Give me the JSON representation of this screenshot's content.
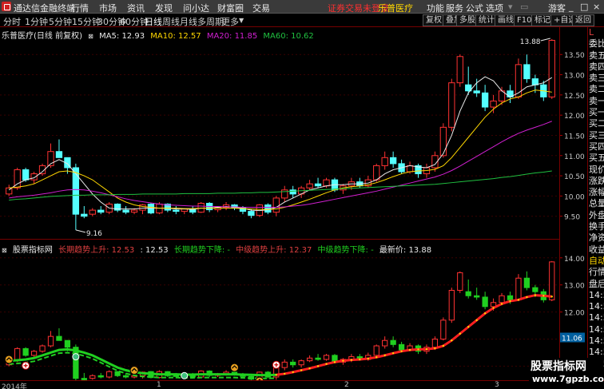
{
  "menubar": {
    "app_title": "通达信金融终端",
    "items": [
      "行情",
      "市场",
      "资讯",
      "发现",
      "问小达",
      "财富圈",
      "交易"
    ],
    "alert": "证券交易未登录",
    "symbol": "乐普医疗",
    "right_items": [
      "功能",
      "服务",
      "公式",
      "选项"
    ],
    "guest": "游客"
  },
  "periodbar": {
    "periods": [
      "分时",
      "1分钟",
      "5分钟",
      "15分钟",
      "30分钟",
      "60分钟",
      "日线",
      "周线",
      "月线",
      "多周期",
      "更多"
    ],
    "active": "日线",
    "tools": [
      "复权",
      "叠加",
      "多股",
      "统计",
      "画线",
      "F10",
      "标记",
      "+自选",
      "返回"
    ]
  },
  "main": {
    "title": "乐普医疗(日线 前复权)",
    "ma": [
      {
        "label": "MA5: 12.93",
        "color": "#e8e8e8"
      },
      {
        "label": "MA10: 12.57",
        "color": "#ffd700"
      },
      {
        "label": "MA20: 11.85",
        "color": "#d020d0"
      },
      {
        "label": "MA60: 10.62",
        "color": "#20c040"
      }
    ],
    "high_label": "13.88",
    "low_label": "9.16"
  },
  "axis": {
    "main_ticks": [
      "13.50",
      "13.00",
      "12.50",
      "12.00",
      "11.50",
      "11.00",
      "10.50",
      "10.00",
      "9.50"
    ],
    "sub_ticks": [
      "14.00",
      "13.00",
      "12.00",
      "11.00",
      "10.00"
    ],
    "current_price": "11.06"
  },
  "sub": {
    "name": "股票指标网",
    "labels": [
      {
        "text": "长期趋势上升: 12.53",
        "color": "#e04040"
      },
      {
        "text": ": 12.53",
        "color": "#e8e8e8"
      },
      {
        "text": "长期趋势下降: -",
        "color": "#20d020"
      },
      {
        "text": "中级趋势上升: 12.37",
        "color": "#e04040"
      },
      {
        "text": "中级趋势下降: -",
        "color": "#20d020"
      },
      {
        "text": "最新价: 13.88",
        "color": "#e8e8e8"
      }
    ]
  },
  "sidepanel": {
    "items": [
      {
        "text": "L",
        "cls": "red"
      },
      {
        "text": "委比",
        "cls": "wht"
      },
      {
        "text": "卖五",
        "cls": "wht"
      },
      {
        "text": "卖四",
        "cls": "wht"
      },
      {
        "text": "卖三",
        "cls": "wht"
      },
      {
        "text": "卖二",
        "cls": "wht"
      },
      {
        "text": "卖一",
        "cls": "wht"
      },
      {
        "text": "买一",
        "cls": "wht"
      },
      {
        "text": "买二",
        "cls": "wht"
      },
      {
        "text": "买三",
        "cls": "wht"
      },
      {
        "text": "买四",
        "cls": "wht"
      },
      {
        "text": "买五",
        "cls": "wht"
      },
      {
        "text": "现价",
        "cls": "wht"
      },
      {
        "text": "涨跌",
        "cls": "wht"
      },
      {
        "text": "涨幅",
        "cls": "wht"
      },
      {
        "text": "总量",
        "cls": "wht"
      },
      {
        "text": "外盘",
        "cls": "wht"
      },
      {
        "text": "换手",
        "cls": "wht"
      },
      {
        "text": "净资",
        "cls": "wht"
      },
      {
        "text": "收益",
        "cls": "wht"
      },
      {
        "text": "自动",
        "cls": "yel"
      },
      {
        "text": "行情",
        "cls": "wht"
      },
      {
        "text": "盘后",
        "cls": "wht"
      },
      {
        "text": "14:50",
        "cls": "wht"
      },
      {
        "text": "14:50",
        "cls": "wht"
      },
      {
        "text": "14:50",
        "cls": "wht"
      },
      {
        "text": "14:50",
        "cls": "wht"
      },
      {
        "text": "14:50",
        "cls": "wht"
      },
      {
        "text": "14:50",
        "cls": "wht"
      },
      {
        "text": "14:51",
        "cls": "wht"
      }
    ]
  },
  "timeline": {
    "labels": [
      "2014年",
      "1",
      "2",
      "3"
    ]
  },
  "watermark": {
    "title": "股票指标网",
    "url": "www.7gpzb.com"
  },
  "colors": {
    "up": "#ff3232",
    "down": "#54ffff",
    "bg": "#000000",
    "grid": "#700000"
  },
  "chart_data": {
    "type": "candlestick",
    "candles": [
      [
        10.05,
        10.28,
        10.0,
        10.2
      ],
      [
        10.2,
        10.7,
        10.15,
        10.65
      ],
      [
        10.65,
        10.7,
        10.35,
        10.4
      ],
      [
        10.4,
        10.6,
        10.3,
        10.55
      ],
      [
        10.55,
        10.8,
        10.5,
        10.75
      ],
      [
        10.75,
        11.3,
        10.7,
        11.1
      ],
      [
        11.1,
        11.4,
        10.95,
        10.95
      ],
      [
        10.95,
        10.95,
        10.55,
        10.7
      ],
      [
        10.7,
        10.8,
        9.16,
        9.55
      ],
      [
        9.55,
        9.75,
        9.45,
        9.5
      ],
      [
        9.55,
        9.7,
        9.5,
        9.65
      ],
      [
        9.65,
        9.75,
        9.55,
        9.6
      ],
      [
        9.6,
        9.85,
        9.55,
        9.8
      ],
      [
        9.8,
        9.82,
        9.6,
        9.65
      ],
      [
        9.65,
        9.75,
        9.55,
        9.6
      ],
      [
        9.6,
        9.7,
        9.55,
        9.65
      ],
      [
        9.65,
        9.8,
        9.55,
        9.78
      ],
      [
        9.8,
        9.82,
        9.55,
        9.58
      ],
      [
        9.58,
        9.85,
        9.55,
        9.8
      ],
      [
        9.8,
        9.82,
        9.6,
        9.65
      ],
      [
        9.65,
        9.75,
        9.55,
        9.62
      ],
      [
        9.62,
        9.7,
        9.55,
        9.68
      ],
      [
        9.68,
        9.75,
        9.55,
        9.6
      ],
      [
        9.6,
        9.85,
        9.58,
        9.82
      ],
      [
        9.82,
        9.85,
        9.6,
        9.66
      ],
      [
        9.66,
        9.75,
        9.6,
        9.72
      ],
      [
        9.72,
        9.85,
        9.65,
        9.78
      ],
      [
        9.78,
        9.8,
        9.65,
        9.7
      ],
      [
        9.7,
        9.75,
        9.55,
        9.62
      ],
      [
        9.62,
        9.68,
        9.45,
        9.52
      ],
      [
        9.52,
        9.8,
        9.48,
        9.78
      ],
      [
        9.78,
        9.82,
        9.55,
        9.6
      ],
      [
        9.6,
        10.0,
        9.5,
        9.95
      ],
      [
        9.95,
        10.25,
        9.85,
        10.15
      ],
      [
        10.15,
        10.25,
        9.95,
        10.05
      ],
      [
        10.05,
        10.25,
        9.95,
        10.2
      ],
      [
        10.2,
        10.4,
        10.15,
        10.3
      ],
      [
        10.3,
        10.45,
        10.2,
        10.25
      ],
      [
        10.25,
        10.45,
        10.2,
        10.4
      ],
      [
        10.4,
        10.45,
        10.1,
        10.15
      ],
      [
        10.15,
        10.3,
        10.05,
        10.25
      ],
      [
        10.25,
        10.45,
        10.15,
        10.35
      ],
      [
        10.35,
        10.45,
        10.2,
        10.25
      ],
      [
        10.25,
        10.5,
        10.2,
        10.4
      ],
      [
        10.4,
        10.8,
        10.35,
        10.75
      ],
      [
        10.75,
        11.1,
        10.65,
        10.95
      ],
      [
        10.95,
        11.1,
        10.7,
        10.8
      ],
      [
        10.8,
        10.9,
        10.55,
        10.6
      ],
      [
        10.6,
        10.85,
        10.55,
        10.75
      ],
      [
        10.75,
        10.8,
        10.45,
        10.55
      ],
      [
        10.55,
        10.8,
        10.45,
        10.7
      ],
      [
        10.7,
        11.1,
        10.6,
        11.0
      ],
      [
        11.0,
        11.8,
        10.95,
        11.7
      ],
      [
        11.7,
        12.9,
        11.6,
        12.8
      ],
      [
        12.8,
        13.5,
        12.7,
        13.45
      ],
      [
        12.75,
        13.2,
        12.5,
        12.6
      ],
      [
        12.6,
        12.9,
        12.45,
        12.55
      ],
      [
        12.55,
        12.75,
        12.1,
        12.2
      ],
      [
        12.2,
        12.5,
        12.05,
        12.35
      ],
      [
        12.35,
        12.7,
        12.25,
        12.6
      ],
      [
        12.6,
        12.75,
        12.3,
        12.45
      ],
      [
        12.45,
        13.4,
        12.4,
        13.25
      ],
      [
        13.25,
        13.5,
        12.8,
        12.9
      ],
      [
        12.9,
        13.0,
        12.55,
        12.75
      ],
      [
        12.75,
        12.85,
        12.35,
        12.45
      ],
      [
        12.45,
        13.88,
        12.4,
        13.85
      ]
    ],
    "ma5": [
      10.15,
      10.3,
      10.4,
      10.45,
      10.6,
      10.8,
      10.9,
      10.8,
      10.55,
      10.3,
      10.05,
      9.85,
      9.7,
      9.68,
      9.68,
      9.68,
      9.7,
      9.7,
      9.7,
      9.7,
      9.68,
      9.68,
      9.67,
      9.7,
      9.7,
      9.72,
      9.74,
      9.72,
      9.7,
      9.65,
      9.64,
      9.66,
      9.72,
      9.85,
      9.95,
      10.05,
      10.15,
      10.2,
      10.25,
      10.28,
      10.28,
      10.3,
      10.3,
      10.32,
      10.4,
      10.55,
      10.65,
      10.7,
      10.75,
      10.72,
      10.7,
      10.78,
      11.05,
      11.5,
      12.1,
      12.55,
      12.8,
      12.95,
      12.85,
      12.6,
      12.45,
      12.55,
      12.7,
      12.75,
      12.8,
      12.93
    ],
    "ma10": [
      10.2,
      10.22,
      10.25,
      10.3,
      10.4,
      10.5,
      10.6,
      10.62,
      10.58,
      10.5,
      10.4,
      10.25,
      10.1,
      9.95,
      9.85,
      9.78,
      9.74,
      9.72,
      9.7,
      9.7,
      9.7,
      9.69,
      9.69,
      9.7,
      9.7,
      9.7,
      9.7,
      9.7,
      9.69,
      9.68,
      9.67,
      9.67,
      9.68,
      9.72,
      9.78,
      9.85,
      9.92,
      10.0,
      10.08,
      10.15,
      10.2,
      10.23,
      10.25,
      10.28,
      10.33,
      10.4,
      10.48,
      10.55,
      10.6,
      10.62,
      10.63,
      10.66,
      10.75,
      10.95,
      11.2,
      11.45,
      11.7,
      11.95,
      12.15,
      12.3,
      12.4,
      12.45,
      12.55,
      12.62,
      12.6,
      12.57
    ],
    "ma20": [
      9.95,
      9.98,
      10.0,
      10.02,
      10.05,
      10.08,
      10.12,
      10.15,
      10.16,
      10.15,
      10.12,
      10.08,
      10.03,
      9.98,
      9.93,
      9.89,
      9.86,
      9.83,
      9.8,
      9.78,
      9.77,
      9.76,
      9.75,
      9.75,
      9.74,
      9.74,
      9.73,
      9.73,
      9.72,
      9.72,
      9.72,
      9.72,
      9.72,
      9.73,
      9.75,
      9.77,
      9.8,
      9.84,
      9.88,
      9.92,
      9.96,
      10.0,
      10.04,
      10.08,
      10.12,
      10.17,
      10.22,
      10.27,
      10.32,
      10.37,
      10.42,
      10.47,
      10.54,
      10.63,
      10.74,
      10.86,
      10.98,
      11.1,
      11.22,
      11.34,
      11.45,
      11.55,
      11.63,
      11.7,
      11.77,
      11.85
    ],
    "ma60": [
      9.9,
      9.92,
      9.93,
      9.95,
      9.97,
      9.99,
      10.0,
      10.01,
      10.02,
      10.02,
      10.03,
      10.03,
      10.03,
      10.04,
      10.04,
      10.04,
      10.05,
      10.05,
      10.05,
      10.05,
      10.05,
      10.06,
      10.06,
      10.06,
      10.06,
      10.07,
      10.07,
      10.07,
      10.08,
      10.08,
      10.09,
      10.09,
      10.1,
      10.11,
      10.12,
      10.13,
      10.14,
      10.15,
      10.16,
      10.17,
      10.18,
      10.19,
      10.2,
      10.21,
      10.22,
      10.23,
      10.24,
      10.25,
      10.26,
      10.27,
      10.28,
      10.29,
      10.31,
      10.33,
      10.35,
      10.37,
      10.39,
      10.41,
      10.43,
      10.46,
      10.48,
      10.51,
      10.54,
      10.57,
      10.59,
      10.62
    ],
    "ylim_main": [
      9.0,
      13.9
    ],
    "ylim_sub": [
      9.6,
      14.2
    ]
  }
}
